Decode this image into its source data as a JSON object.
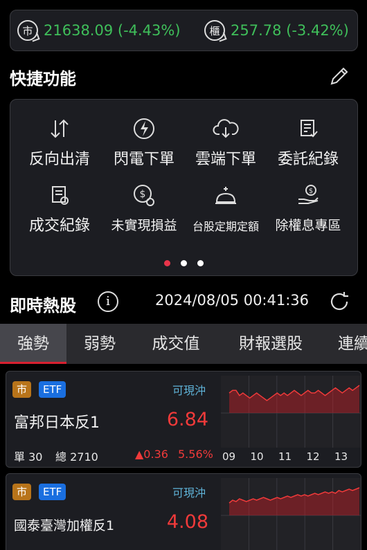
{
  "index_bar": {
    "twse": {
      "badge": "市",
      "value": "21638.09 (-4.43%)"
    },
    "otc": {
      "badge": "櫃",
      "value": "257.78 (-3.42%)"
    }
  },
  "quick_functions": {
    "title": "快捷功能",
    "items": [
      {
        "label": "反向出清",
        "icon": "reverse-arrows-icon"
      },
      {
        "label": "閃電下單",
        "icon": "lightning-icon"
      },
      {
        "label": "雲端下單",
        "icon": "cloud-download-icon"
      },
      {
        "label": "委託紀錄",
        "icon": "order-record-icon"
      },
      {
        "label": "成交紀錄",
        "icon": "trade-record-icon"
      },
      {
        "label": "未實現損益",
        "icon": "unrealized-pnl-icon"
      },
      {
        "label": "台股定期定額",
        "icon": "piggy-bank-icon"
      },
      {
        "label": "除權息專區",
        "icon": "dividend-hand-icon"
      }
    ],
    "page_count": 3,
    "active_page": 0
  },
  "hot_stocks": {
    "title": "即時熱股",
    "timestamp": "2024/08/05 00:41:36"
  },
  "tabs": [
    "強勢",
    "弱勢",
    "成交值",
    "財報選股",
    "連續"
  ],
  "active_tab": 0,
  "stocks": [
    {
      "market_tag": "市",
      "type_tag": "ETF",
      "day_trade": "可現沖",
      "name": "富邦日本反1",
      "price": "6.84",
      "single": "單 30",
      "total": "總 2710",
      "change": "▲0.36",
      "change_pct": "5.56%",
      "time_labels": [
        "09",
        "10",
        "11",
        "12",
        "13"
      ],
      "trend": [
        6.62,
        6.63,
        6.63,
        6.61,
        6.62,
        6.61,
        6.6,
        6.61,
        6.62,
        6.61,
        6.6,
        6.59,
        6.6,
        6.61,
        6.62,
        6.61,
        6.62,
        6.61,
        6.62,
        6.63,
        6.62,
        6.61,
        6.62,
        6.63,
        6.62,
        6.62,
        6.63,
        6.62,
        6.61,
        6.62,
        6.63,
        6.64,
        6.63,
        6.62,
        6.63,
        6.64,
        6.63,
        6.64,
        6.65
      ]
    },
    {
      "market_tag": "市",
      "type_tag": "ETF",
      "day_trade": "可現沖",
      "name": "國泰臺灣加權反1",
      "price": "4.08",
      "trend": [
        3.96,
        3.98,
        3.97,
        3.99,
        3.98,
        3.97,
        3.98,
        3.99,
        3.98,
        3.99,
        4.0,
        3.99,
        3.98,
        3.99,
        4.0,
        3.99,
        4.0,
        4.01,
        4.0,
        4.01,
        4.02,
        4.01,
        4.02,
        4.01,
        4.02,
        4.03,
        4.02,
        4.03,
        4.04,
        4.03,
        4.04,
        4.03,
        4.05,
        4.04,
        4.05,
        4.06,
        4.05,
        4.06,
        4.07
      ]
    }
  ],
  "colors": {
    "up": "#f03a3a",
    "index_down": "#3fbf5a",
    "accent_tab": "#d82030",
    "day_trade": "#5fb3d8"
  }
}
